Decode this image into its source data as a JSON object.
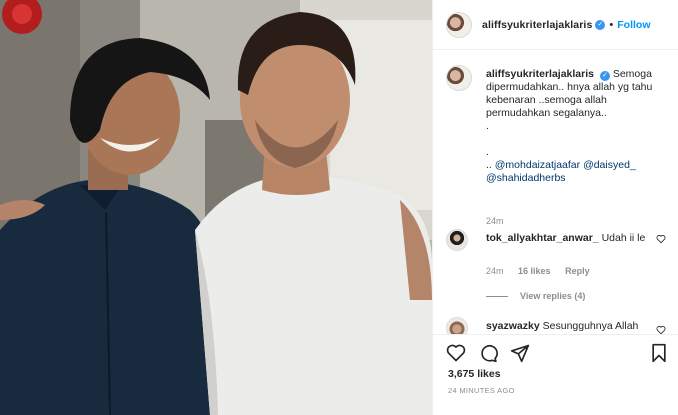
{
  "header": {
    "username": "aliffsyukriterlajaklaris",
    "verified_glyph": "✓",
    "separator": "•",
    "follow_label": "Follow"
  },
  "caption": {
    "username": "aliffsyukriterlajaklaris",
    "lines": [
      "Semoga",
      "dipermudahkan.. hnya allah yg tahu",
      "kebenaran ..semoga allah",
      "permudahkan segalanya..",
      ".",
      ".",
      ".."
    ],
    "mentions": [
      "@mohdaizatjaafar",
      "@daisyed_",
      "@shahidadherbs"
    ],
    "time": "24m"
  },
  "comments": [
    {
      "username": "tok_allyakhtar_anwar_",
      "text": "Udah ii le",
      "time": "24m",
      "likes": "16 likes",
      "reply_label": "Reply",
      "view_replies": "View replies (4)"
    },
    {
      "username": "syazwazky",
      "text": "Sesungguhnya Allah"
    }
  ],
  "actions": {
    "icons": [
      "heart-icon",
      "comment-icon",
      "share-icon",
      "bookmark-icon"
    ],
    "likes_count": "3,675 likes",
    "posted_ago": "24 MINUTES AGO"
  },
  "colors": {
    "accent": "#0095f6",
    "verified": "#3897f0",
    "muted": "#8e8e8e",
    "mention": "#00376b"
  }
}
